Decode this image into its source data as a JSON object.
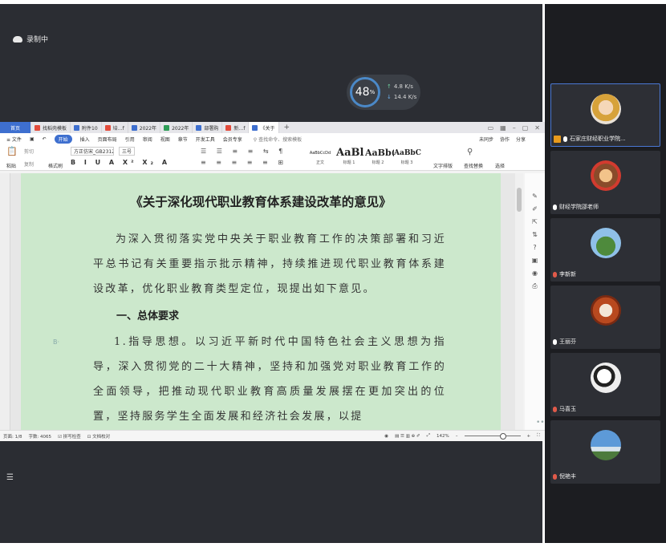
{
  "recording": {
    "label": "录制中"
  },
  "speed_widget": {
    "percent": "48",
    "percent_sign": "%",
    "upload": "4.8",
    "upload_unit": "K/s",
    "download": "14.4",
    "download_unit": "K/s"
  },
  "wps": {
    "tabs": [
      "首页",
      "找稻壳模板",
      "附件10",
      "培…f",
      "2022年",
      "2022年",
      "部署购",
      "新…f",
      "《关于"
    ],
    "plus": "+",
    "menu": [
      "≡ 文件",
      "开始",
      "插入",
      "页面布局",
      "引用",
      "审阅",
      "视图",
      "章节",
      "开发工具",
      "会员专享"
    ],
    "search": "查找命令、搜索模板",
    "menu_right": [
      "未同步",
      "协作",
      "分享"
    ],
    "ribbon": {
      "paste": "粘贴",
      "cut": "剪切",
      "copy": "复制",
      "format_painter": "格式刷",
      "font": "方正仿宋_GB2312",
      "size": "三号",
      "styles": [
        {
          "sample": "AaBbCcDd",
          "label": "正文"
        },
        {
          "sample": "AaBl",
          "label": "标题 1"
        },
        {
          "sample": "AaBb(",
          "label": "标题 2"
        },
        {
          "sample": "AaBbC",
          "label": "标题 3"
        }
      ],
      "text_layout": "文字排版",
      "find_replace": "查找替换",
      "select": "选择"
    },
    "document": {
      "title": "《关于深化现代职业教育体系建设改革的意见》",
      "para1": "为深入贯彻落实党中央关于职业教育工作的决策部署和习近平总书记有关重要指示批示精神，持续推进现代职业教育体系建设改革，优化职业教育类型定位，现提出如下意见。",
      "heading1": "一、总体要求",
      "para2": "1.指导思想。以习近平新时代中国特色社会主义思想为指导，深入贯彻党的二十大精神，坚持和加强党对职业教育工作的全面领导，把推动现代职业教育高质量发展摆在更加突出的位置，坚持服务学生全面发展和经济社会发展，以提"
    },
    "status": {
      "page": "页面: 1/8",
      "words": "字数: 4065",
      "spellcheck": "拼写检查",
      "proof": "文档校对",
      "zoom": "142%"
    }
  },
  "participants": [
    {
      "name": "石家庄财经职业学院...",
      "mic": "on",
      "hand": true
    },
    {
      "name": "财经学院邵老师",
      "mic": "on",
      "hand": false
    },
    {
      "name": "李新新",
      "mic": "muted",
      "hand": false
    },
    {
      "name": "王丽芬",
      "mic": "on",
      "hand": false
    },
    {
      "name": "马喜玉",
      "mic": "muted",
      "hand": false
    },
    {
      "name": "倪艳丰",
      "mic": "muted",
      "hand": false
    }
  ],
  "colors": {
    "accent": "#3e6fcf",
    "doc_background": "#cce8cc",
    "meeting_bg": "#2b2d33"
  }
}
